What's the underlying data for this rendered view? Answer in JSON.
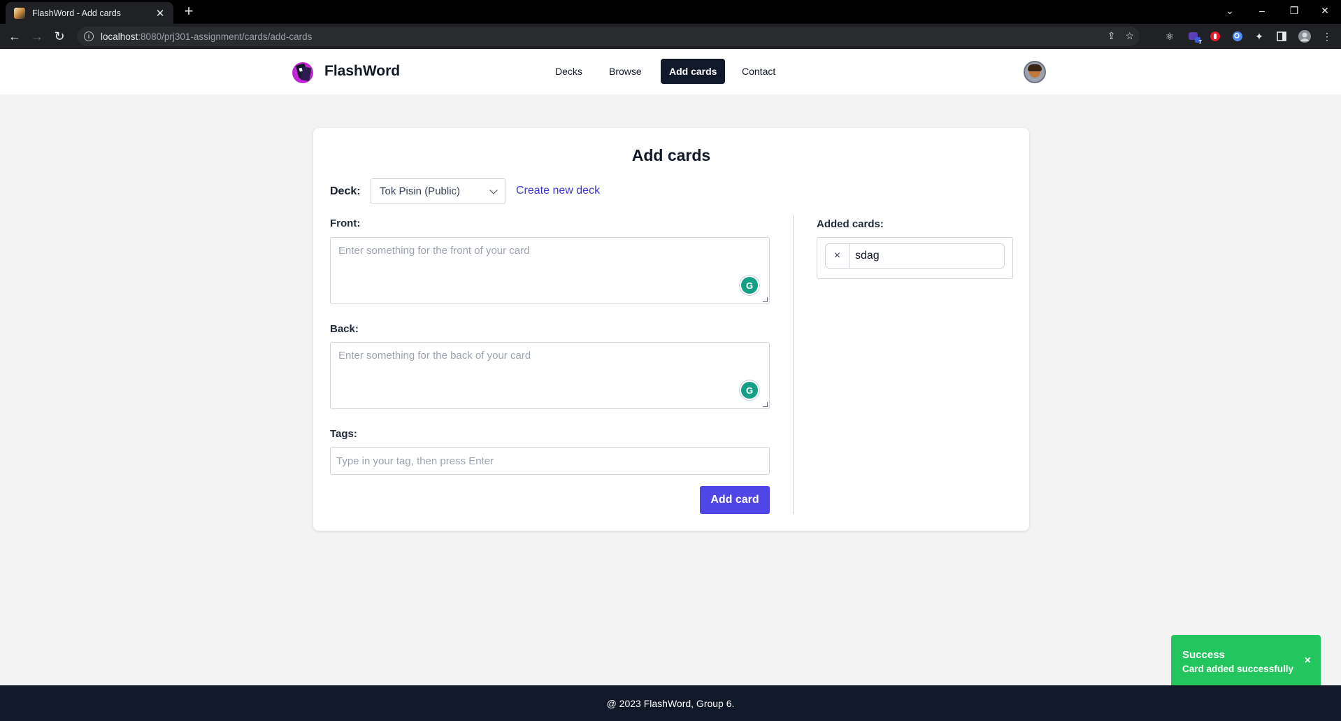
{
  "browser": {
    "tab_title": "FlashWord - Add cards",
    "new_tab": "+",
    "url_host": "localhost",
    "url_rest": ":8080/prj301-assignment/cards/add-cards",
    "window_controls": {
      "dropdown": "⌄",
      "minimize": "–",
      "restore": "❐",
      "close": "✕"
    },
    "extension_badge": "7"
  },
  "header": {
    "brand": "FlashWord",
    "nav": [
      {
        "label": "Decks",
        "active": false
      },
      {
        "label": "Browse",
        "active": false
      },
      {
        "label": "Add cards",
        "active": true
      },
      {
        "label": "Contact",
        "active": false
      }
    ]
  },
  "form": {
    "title": "Add cards",
    "deck_label": "Deck:",
    "deck_selected": "Tok Pisin (Public)",
    "create_deck_link": "Create new deck",
    "front_label": "Front:",
    "front_placeholder": "Enter something for the front of your card",
    "back_label": "Back:",
    "back_placeholder": "Enter something for the back of your card",
    "tags_label": "Tags:",
    "tags_placeholder": "Type in your tag, then press Enter",
    "submit_label": "Add card"
  },
  "added": {
    "label": "Added cards:",
    "cards": [
      "sdag"
    ]
  },
  "toast": {
    "title": "Success",
    "message": "Card added successfully",
    "close": "×"
  },
  "footer": {
    "text": "@ 2023 FlashWord, Group 6."
  },
  "colors": {
    "primary": "#4f46e5",
    "link": "#4338ca",
    "nav_active_bg": "#111827",
    "success": "#22c55e",
    "footer_bg": "#111827",
    "page_bg": "#f3f3f4"
  }
}
